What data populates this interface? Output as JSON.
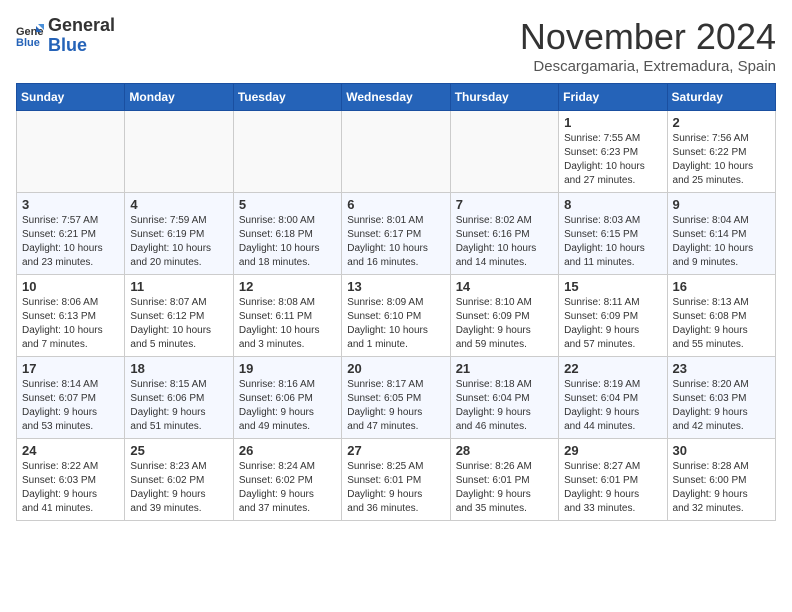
{
  "header": {
    "logo_general": "General",
    "logo_blue": "Blue",
    "month_title": "November 2024",
    "location": "Descargamaria, Extremadura, Spain"
  },
  "weekdays": [
    "Sunday",
    "Monday",
    "Tuesday",
    "Wednesday",
    "Thursday",
    "Friday",
    "Saturday"
  ],
  "weeks": [
    [
      {
        "day": "",
        "detail": ""
      },
      {
        "day": "",
        "detail": ""
      },
      {
        "day": "",
        "detail": ""
      },
      {
        "day": "",
        "detail": ""
      },
      {
        "day": "",
        "detail": ""
      },
      {
        "day": "1",
        "detail": "Sunrise: 7:55 AM\nSunset: 6:23 PM\nDaylight: 10 hours\nand 27 minutes."
      },
      {
        "day": "2",
        "detail": "Sunrise: 7:56 AM\nSunset: 6:22 PM\nDaylight: 10 hours\nand 25 minutes."
      }
    ],
    [
      {
        "day": "3",
        "detail": "Sunrise: 7:57 AM\nSunset: 6:21 PM\nDaylight: 10 hours\nand 23 minutes."
      },
      {
        "day": "4",
        "detail": "Sunrise: 7:59 AM\nSunset: 6:19 PM\nDaylight: 10 hours\nand 20 minutes."
      },
      {
        "day": "5",
        "detail": "Sunrise: 8:00 AM\nSunset: 6:18 PM\nDaylight: 10 hours\nand 18 minutes."
      },
      {
        "day": "6",
        "detail": "Sunrise: 8:01 AM\nSunset: 6:17 PM\nDaylight: 10 hours\nand 16 minutes."
      },
      {
        "day": "7",
        "detail": "Sunrise: 8:02 AM\nSunset: 6:16 PM\nDaylight: 10 hours\nand 14 minutes."
      },
      {
        "day": "8",
        "detail": "Sunrise: 8:03 AM\nSunset: 6:15 PM\nDaylight: 10 hours\nand 11 minutes."
      },
      {
        "day": "9",
        "detail": "Sunrise: 8:04 AM\nSunset: 6:14 PM\nDaylight: 10 hours\nand 9 minutes."
      }
    ],
    [
      {
        "day": "10",
        "detail": "Sunrise: 8:06 AM\nSunset: 6:13 PM\nDaylight: 10 hours\nand 7 minutes."
      },
      {
        "day": "11",
        "detail": "Sunrise: 8:07 AM\nSunset: 6:12 PM\nDaylight: 10 hours\nand 5 minutes."
      },
      {
        "day": "12",
        "detail": "Sunrise: 8:08 AM\nSunset: 6:11 PM\nDaylight: 10 hours\nand 3 minutes."
      },
      {
        "day": "13",
        "detail": "Sunrise: 8:09 AM\nSunset: 6:10 PM\nDaylight: 10 hours\nand 1 minute."
      },
      {
        "day": "14",
        "detail": "Sunrise: 8:10 AM\nSunset: 6:09 PM\nDaylight: 9 hours\nand 59 minutes."
      },
      {
        "day": "15",
        "detail": "Sunrise: 8:11 AM\nSunset: 6:09 PM\nDaylight: 9 hours\nand 57 minutes."
      },
      {
        "day": "16",
        "detail": "Sunrise: 8:13 AM\nSunset: 6:08 PM\nDaylight: 9 hours\nand 55 minutes."
      }
    ],
    [
      {
        "day": "17",
        "detail": "Sunrise: 8:14 AM\nSunset: 6:07 PM\nDaylight: 9 hours\nand 53 minutes."
      },
      {
        "day": "18",
        "detail": "Sunrise: 8:15 AM\nSunset: 6:06 PM\nDaylight: 9 hours\nand 51 minutes."
      },
      {
        "day": "19",
        "detail": "Sunrise: 8:16 AM\nSunset: 6:06 PM\nDaylight: 9 hours\nand 49 minutes."
      },
      {
        "day": "20",
        "detail": "Sunrise: 8:17 AM\nSunset: 6:05 PM\nDaylight: 9 hours\nand 47 minutes."
      },
      {
        "day": "21",
        "detail": "Sunrise: 8:18 AM\nSunset: 6:04 PM\nDaylight: 9 hours\nand 46 minutes."
      },
      {
        "day": "22",
        "detail": "Sunrise: 8:19 AM\nSunset: 6:04 PM\nDaylight: 9 hours\nand 44 minutes."
      },
      {
        "day": "23",
        "detail": "Sunrise: 8:20 AM\nSunset: 6:03 PM\nDaylight: 9 hours\nand 42 minutes."
      }
    ],
    [
      {
        "day": "24",
        "detail": "Sunrise: 8:22 AM\nSunset: 6:03 PM\nDaylight: 9 hours\nand 41 minutes."
      },
      {
        "day": "25",
        "detail": "Sunrise: 8:23 AM\nSunset: 6:02 PM\nDaylight: 9 hours\nand 39 minutes."
      },
      {
        "day": "26",
        "detail": "Sunrise: 8:24 AM\nSunset: 6:02 PM\nDaylight: 9 hours\nand 37 minutes."
      },
      {
        "day": "27",
        "detail": "Sunrise: 8:25 AM\nSunset: 6:01 PM\nDaylight: 9 hours\nand 36 minutes."
      },
      {
        "day": "28",
        "detail": "Sunrise: 8:26 AM\nSunset: 6:01 PM\nDaylight: 9 hours\nand 35 minutes."
      },
      {
        "day": "29",
        "detail": "Sunrise: 8:27 AM\nSunset: 6:01 PM\nDaylight: 9 hours\nand 33 minutes."
      },
      {
        "day": "30",
        "detail": "Sunrise: 8:28 AM\nSunset: 6:00 PM\nDaylight: 9 hours\nand 32 minutes."
      }
    ]
  ]
}
